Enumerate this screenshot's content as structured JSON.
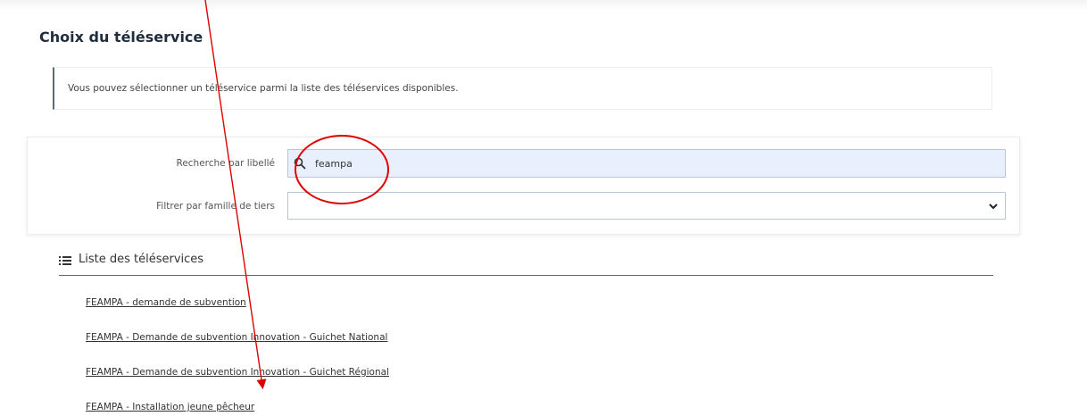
{
  "page": {
    "title": "Choix du téléservice"
  },
  "info": {
    "text": "Vous pouvez sélectionner un téléservice parmi la liste des téléservices disponibles."
  },
  "filters": {
    "search_label": "Recherche par libellé",
    "search_value": "feampa",
    "family_label": "Filtrer par famille de tiers",
    "family_value": ""
  },
  "list": {
    "title": "Liste des téléservices",
    "items": [
      {
        "label": "FEAMPA - demande de subvention"
      },
      {
        "label": "FEAMPA - Demande de subvention Innovation - Guichet National"
      },
      {
        "label": "FEAMPA - Demande de subvention Innovation - Guichet Régional"
      },
      {
        "label": "FEAMPA - Installation jeune pêcheur"
      }
    ]
  },
  "annotation": {
    "color": "#e00000"
  },
  "icons": {
    "search": "search-icon",
    "select": "chevron-down-icon",
    "list": "list-icon"
  }
}
